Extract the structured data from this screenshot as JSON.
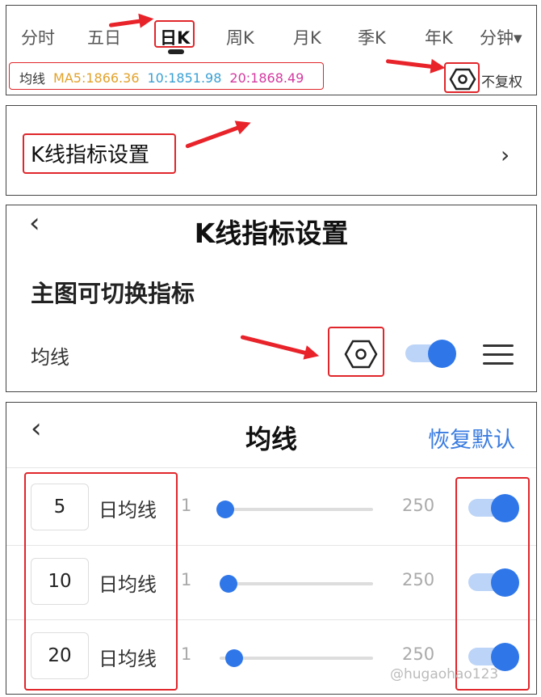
{
  "panel1": {
    "tabs": [
      {
        "label": "分时"
      },
      {
        "label": "五日"
      },
      {
        "label": "日K"
      },
      {
        "label": "周K"
      },
      {
        "label": "月K"
      },
      {
        "label": "季K"
      },
      {
        "label": "年K"
      },
      {
        "label": "分钟▾"
      }
    ],
    "active_tab": "日K",
    "ma_label": "均线",
    "ma5": "MA5:1866.36",
    "ma10": "10:1851.98",
    "ma20": "20:1868.49",
    "adjust_label": "不复权",
    "colors": {
      "ma5": "#e2a22b",
      "ma10": "#3aa0d4",
      "ma20": "#d43aa0",
      "highlight": "#e0262b"
    }
  },
  "panel2": {
    "label": "K线指标设置",
    "chevron": "›"
  },
  "panel3": {
    "back": "‹",
    "title": "K线指标设置",
    "section": "主图可切换指标",
    "item_label": "均线",
    "toggle_on": true
  },
  "panel4": {
    "back": "‹",
    "title": "均线",
    "restore_default": "恢复默认",
    "items": [
      {
        "days": "5",
        "label": "日均线",
        "min": "1",
        "max": "250",
        "value": 5,
        "enabled": true
      },
      {
        "days": "10",
        "label": "日均线",
        "min": "1",
        "max": "250",
        "value": 10,
        "enabled": true
      },
      {
        "days": "20",
        "label": "日均线",
        "min": "1",
        "max": "250",
        "value": 20,
        "enabled": true
      }
    ],
    "accent": "#2f77e9"
  },
  "watermark": "@hugaohao123"
}
